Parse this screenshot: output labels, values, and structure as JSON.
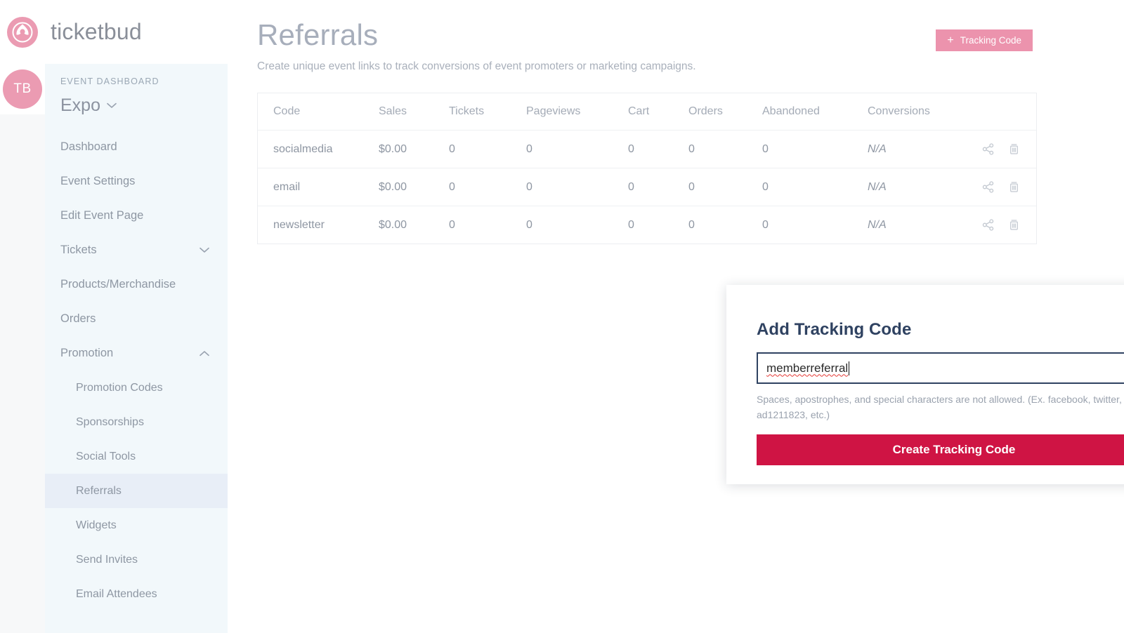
{
  "brand": {
    "name": "ticketbud",
    "logo_icon": "ticketbud-bud-logo-icon"
  },
  "user": {
    "initials": "TB"
  },
  "sidebar": {
    "section_label": "EVENT DASHBOARD",
    "event_name": "Expo",
    "event_chevron_icon": "chevron-down-icon",
    "items": [
      {
        "label": "Dashboard",
        "level": "top",
        "chevron": "",
        "active": false
      },
      {
        "label": "Event Settings",
        "level": "top",
        "chevron": "",
        "active": false
      },
      {
        "label": "Edit Event Page",
        "level": "top",
        "chevron": "",
        "active": false
      },
      {
        "label": "Tickets",
        "level": "top",
        "chevron": "chevron-down-icon",
        "active": false
      },
      {
        "label": "Products/Merchandise",
        "level": "top",
        "chevron": "",
        "active": false
      },
      {
        "label": "Orders",
        "level": "top",
        "chevron": "",
        "active": false
      },
      {
        "label": "Promotion",
        "level": "top",
        "chevron": "chevron-up-icon",
        "active": false
      },
      {
        "label": "Promotion Codes",
        "level": "sub",
        "chevron": "",
        "active": false
      },
      {
        "label": "Sponsorships",
        "level": "sub",
        "chevron": "",
        "active": false
      },
      {
        "label": "Social Tools",
        "level": "sub",
        "chevron": "",
        "active": false
      },
      {
        "label": "Referrals",
        "level": "sub",
        "chevron": "",
        "active": true
      },
      {
        "label": "Widgets",
        "level": "sub",
        "chevron": "",
        "active": false
      },
      {
        "label": "Send Invites",
        "level": "sub",
        "chevron": "",
        "active": false
      },
      {
        "label": "Email Attendees",
        "level": "sub",
        "chevron": "",
        "active": false
      }
    ]
  },
  "page": {
    "title": "Referrals",
    "subtitle": "Create unique event links to track conversions of event promoters or marketing campaigns."
  },
  "toolbar": {
    "add_tracking_code_label": "Tracking Code",
    "add_icon": "plus-icon",
    "accent_color": "#ec93ad"
  },
  "table": {
    "columns": [
      "Code",
      "Sales",
      "Tickets",
      "Pageviews",
      "Cart",
      "Orders",
      "Abandoned",
      "Conversions"
    ],
    "rows": [
      {
        "code": "socialmedia",
        "sales": "$0.00",
        "tickets": "0",
        "pageviews": "0",
        "cart": "0",
        "orders": "0",
        "abandoned": "0",
        "conversions": "N/A"
      },
      {
        "code": "email",
        "sales": "$0.00",
        "tickets": "0",
        "pageviews": "0",
        "cart": "0",
        "orders": "0",
        "abandoned": "0",
        "conversions": "N/A"
      },
      {
        "code": "newsletter",
        "sales": "$0.00",
        "tickets": "0",
        "pageviews": "0",
        "cart": "0",
        "orders": "0",
        "abandoned": "0",
        "conversions": "N/A"
      }
    ],
    "row_action_icons": [
      "share-icon",
      "trash-icon"
    ]
  },
  "modal": {
    "title": "Add Tracking Code",
    "close_icon": "close-icon",
    "input_value": "memberreferral",
    "input_placeholder": "",
    "hint": "Spaces, apostrophes, and special characters are not allowed. (Ex. facebook, twitter, ad1211823, etc.)",
    "submit_label": "Create Tracking Code",
    "submit_color": "#cf1444"
  }
}
